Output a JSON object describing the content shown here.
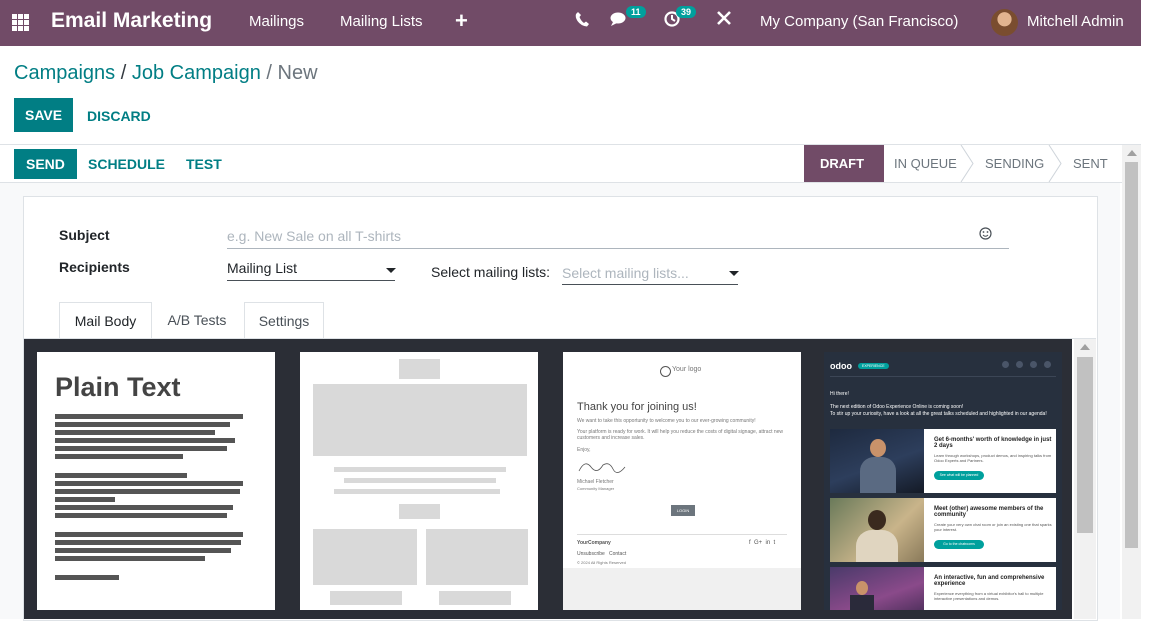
{
  "colors": {
    "brand": "#714b67",
    "accent": "#017e84",
    "badge": "#00a09d"
  },
  "navbar": {
    "app_name": "Email Marketing",
    "menu": [
      "Mailings",
      "Mailing Lists"
    ],
    "add_icon": "plus-icon",
    "phone_icon": "phone-icon",
    "messages_badge": "11",
    "activities_badge": "39",
    "company": "My Company (San Francisco)",
    "user": "Mitchell Admin"
  },
  "breadcrumb": {
    "parent": "Campaigns",
    "sep1": "/",
    "campaign": "Job Campaign",
    "sep2": "/",
    "current": "New"
  },
  "actions": {
    "save": "SAVE",
    "discard": "DISCARD"
  },
  "header_buttons": {
    "send": "SEND",
    "schedule": "SCHEDULE",
    "test": "TEST"
  },
  "stages": [
    "DRAFT",
    "IN QUEUE",
    "SENDING",
    "SENT"
  ],
  "form": {
    "subject_label": "Subject",
    "subject_placeholder": "e.g. New Sale on all T-shirts",
    "recipients_label": "Recipients",
    "recipients_value": "Mailing List",
    "mailing_lists_label": "Select mailing lists:",
    "mailing_lists_placeholder": "Select mailing lists..."
  },
  "tabs": [
    "Mail Body",
    "A/B Tests",
    "Settings"
  ],
  "themes": {
    "plain_text": "Plain Text",
    "logo": "Your logo",
    "welcome_title": "Thank you for joining us!",
    "welcome_line1": "We want to take this opportunity to welcome you to our ever-growing community!",
    "welcome_line2": "Your platform is ready for work. It will help you reduce the costs of digital signage, attract new customers and increase sales.",
    "welcome_enjoy": "Enjoy,",
    "signer": "Michael Fletcher",
    "signer_role": "Community Manager",
    "login": "LOGIN",
    "your_company": "YourCompany",
    "unsubscribe": "Unsubscribe",
    "contact": "Contact",
    "rights": "© 2024 All Rights Reserved",
    "odoo_brand": "odoo",
    "odoo_tag": "EXPERIENCE",
    "hi_there": "Hi there!",
    "event_intro": "The next edition of Odoo Experience Online is coming soon!",
    "event_intro2": "To stir up your curiosity, have a look at all the great talks scheduled and highlighted in our agenda!",
    "block1_title": "Get 6-months' worth of knowledge in just 2 days",
    "block1_text": "Learn through workshops, product demos, and inspiring talks from Odoo Experts and Partners.",
    "block1_btn": "See what will be planned",
    "block2_title": "Meet (other) awesome members of the community",
    "block2_text": "Create your very own chat room or join an existing one that sparks your interest.",
    "block2_btn": "Go to the chatrooms",
    "block3_title": "An interactive, fun and comprehensive experience",
    "block3_text": "Experience everything from a virtual exhibitor's hall to multiple interactive presentations and demos."
  }
}
